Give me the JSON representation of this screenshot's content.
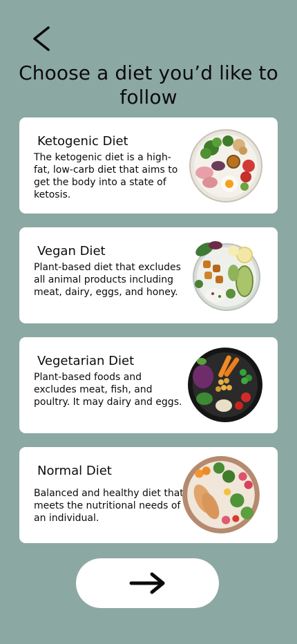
{
  "header": {
    "title": "Choose a diet you’d like to follow",
    "back_icon": "chevron-left-icon"
  },
  "diets": [
    {
      "title": "Ketogenic Diet",
      "description": "The ketogenic diet is a high-fat, low-carb diet that aims to get the body into a state of ketosis.",
      "image": "keto-food-bowl-image"
    },
    {
      "title": "Vegan Diet",
      "description": "Plant-based diet that excludes all animal products including meat, dairy, eggs, and honey.",
      "image": "vegan-food-bowl-image"
    },
    {
      "title": "Vegetarian Diet",
      "description": "Plant-based foods and excludes meat, fish, and poultry. It may dairy and eggs.",
      "image": "vegetarian-food-bowl-image"
    },
    {
      "title": "Normal Diet",
      "description": "Balanced and healthy diet that meets the nutritional needs of an individual.",
      "image": "normal-food-bowl-image"
    }
  ],
  "footer": {
    "next_icon": "arrow-right-icon"
  },
  "colors": {
    "background": "#8CA8A3",
    "card": "#FFFFFF",
    "text": "#0B0B0B"
  }
}
